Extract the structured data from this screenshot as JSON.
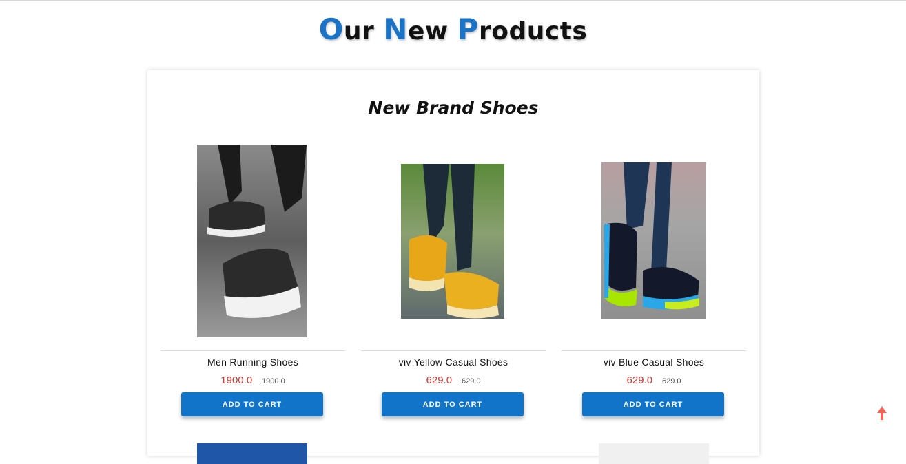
{
  "page_title": {
    "o": "O",
    "ur": "ur ",
    "n": "N",
    "ew": "ew ",
    "p": "P",
    "roducts": "roducts"
  },
  "accent_color": "#1a73c7",
  "section_title": "New Brand Shoes",
  "products": [
    {
      "name": "Men Running Shoes",
      "price": "1900.0",
      "old_price": "1900.0",
      "cart_label": "ADD TO CART"
    },
    {
      "name": "viv Yellow Casual Shoes",
      "price": "629.0",
      "old_price": "629.0",
      "cart_label": "ADD TO CART"
    },
    {
      "name": "viv Blue Casual Shoes",
      "price": "629.0",
      "old_price": "629.0",
      "cart_label": "ADD TO CART"
    }
  ],
  "icons": {
    "scroll_top": "arrow-up-icon"
  }
}
